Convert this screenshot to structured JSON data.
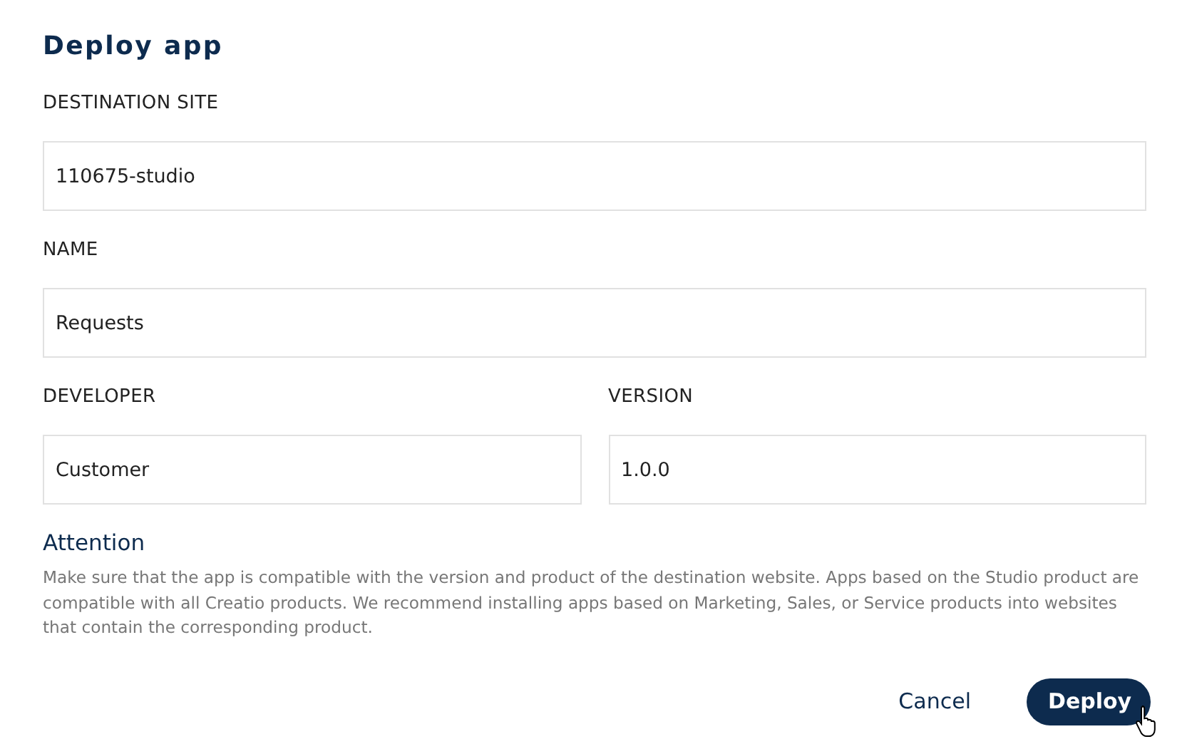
{
  "title": "Deploy app",
  "rows": [
    [
      {
        "label": "DESTINATION SITE",
        "value": "110675-studio"
      }
    ],
    [
      {
        "label": "NAME",
        "value": "Requests"
      }
    ],
    [
      {
        "label": "DEVELOPER",
        "value": "Customer"
      },
      {
        "label": "VERSION",
        "value": "1.0.0"
      }
    ]
  ],
  "attention": {
    "heading": "Attention",
    "text": "Make sure that the app is compatible with the version and product of the destination website. Apps based on the Studio product are compatible with all Creatio products. We recommend installing apps based on Marketing, Sales, or Service products into websites that contain the corresponding product."
  },
  "buttons": [
    {
      "label": "Cancel",
      "kind": "text"
    },
    {
      "label": "Deploy",
      "kind": "primary"
    }
  ]
}
